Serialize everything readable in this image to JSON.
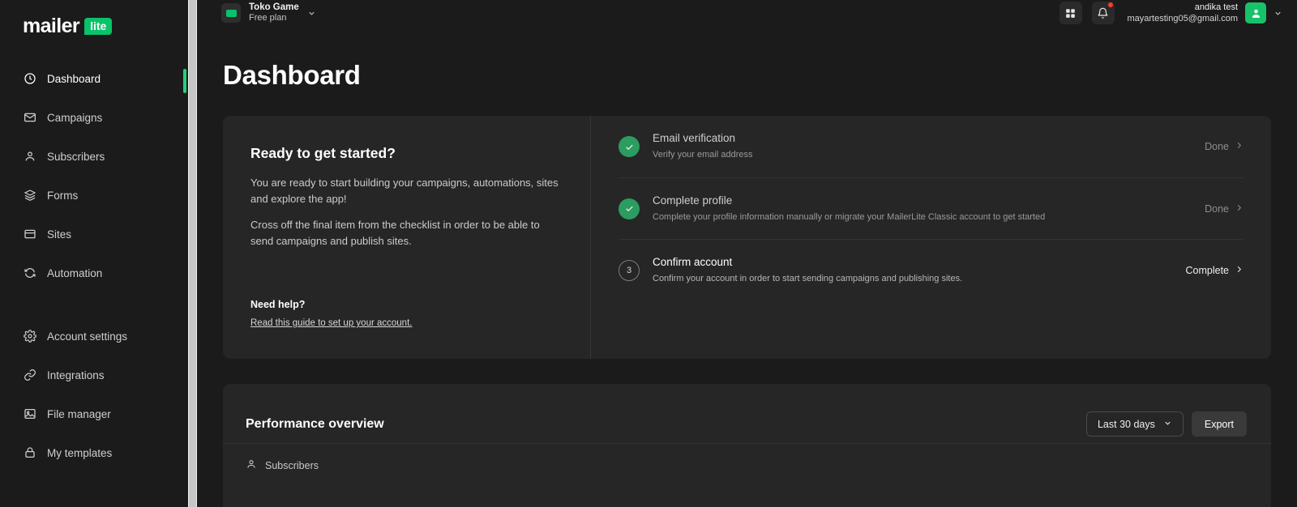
{
  "brand": {
    "logo_text": "mailer",
    "logo_badge": "lite",
    "accent_green": "#09C269",
    "active_marker": "#21d17a"
  },
  "sidebar": {
    "items": [
      {
        "label": "Dashboard",
        "icon": "clock-icon",
        "active": true
      },
      {
        "label": "Campaigns",
        "icon": "envelope-icon",
        "active": false
      },
      {
        "label": "Subscribers",
        "icon": "person-icon",
        "active": false
      },
      {
        "label": "Forms",
        "icon": "layers-icon",
        "active": false
      },
      {
        "label": "Sites",
        "icon": "window-icon",
        "active": false
      },
      {
        "label": "Automation",
        "icon": "refresh-icon",
        "active": false
      },
      {
        "label": "Account settings",
        "icon": "gear-icon",
        "active": false
      },
      {
        "label": "Integrations",
        "icon": "link-icon",
        "active": false
      },
      {
        "label": "File manager",
        "icon": "image-icon",
        "active": false
      },
      {
        "label": "My templates",
        "icon": "lock-icon",
        "active": false
      }
    ]
  },
  "topbar": {
    "account": {
      "name": "Toko Game",
      "plan": "Free plan",
      "chevron_icon": "chevron-down-icon",
      "logo_icon": "account-logo-icon"
    },
    "apps_icon": "grid-apps-icon",
    "notifications_icon": "bell-icon",
    "has_notification": true,
    "user": {
      "name": "andika test",
      "email": "mayartesting05@gmail.com",
      "avatar_icon": "person-avatar-icon",
      "chevron_icon": "chevron-down-icon"
    }
  },
  "page": {
    "title": "Dashboard"
  },
  "get_started": {
    "heading": "Ready to get started?",
    "paragraph_1": "You are ready to start building your campaigns, automations, sites and explore the app!",
    "paragraph_2": "Cross off the final item from the checklist in order to be able to send campaigns and publish sites.",
    "help_heading": "Need help?",
    "help_link": "Read this guide to set up your account.",
    "checklist": [
      {
        "badge": "check-icon",
        "state": "done",
        "title": "Email verification",
        "subtitle": "Verify your email address",
        "action": "Done"
      },
      {
        "badge": "check-icon",
        "state": "done",
        "title": "Complete profile",
        "subtitle": "Complete your profile information manually or migrate your MailerLite Classic account to get started",
        "action": "Done"
      },
      {
        "badge": "3",
        "state": "pending",
        "title": "Confirm account",
        "subtitle": "Confirm your account in order to start sending campaigns and publishing sites.",
        "action": "Complete"
      }
    ]
  },
  "performance": {
    "title": "Performance overview",
    "date_range": "Last 30 days",
    "date_range_icon": "chevron-down-icon",
    "export_label": "Export",
    "metric_tab": "Subscribers",
    "metric_tab_icon": "person-icon"
  }
}
